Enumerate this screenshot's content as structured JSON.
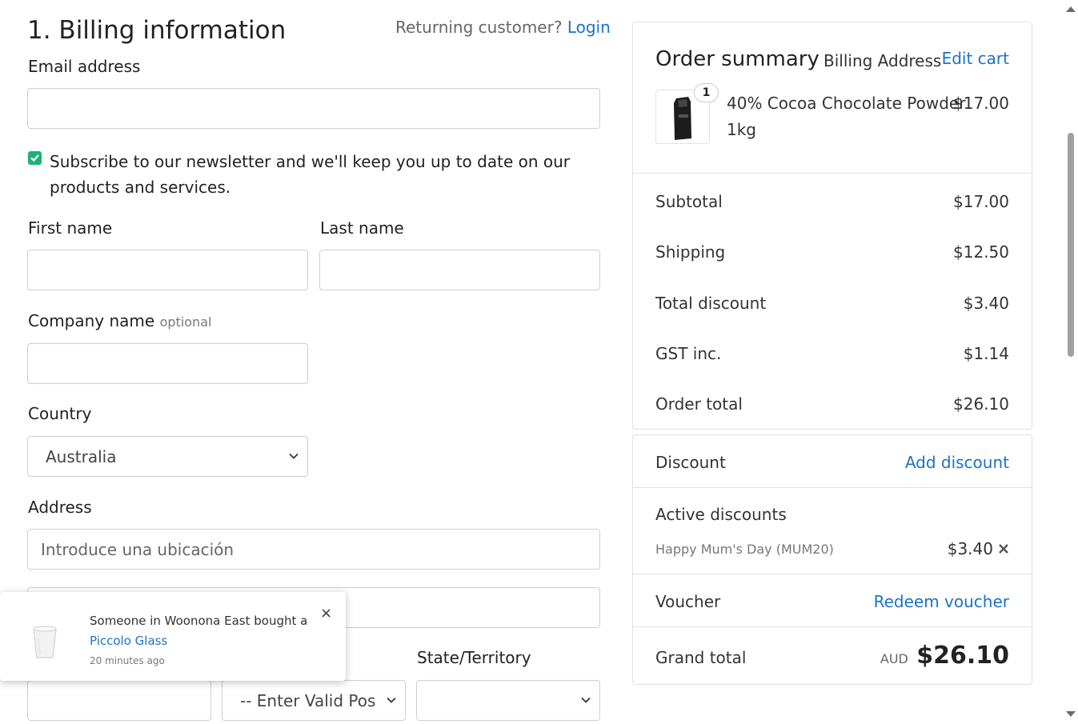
{
  "billing": {
    "title": "1. Billing information",
    "returning_text": "Returning customer?",
    "login_label": "Login",
    "email_label": "Email address",
    "newsletter_label": "Subscribe to our newsletter and we'll keep you up to date on our products and services.",
    "newsletter_checked": true,
    "first_name_label": "First name",
    "last_name_label": "Last name",
    "company_label": "Company name",
    "company_optional": "optional",
    "country_label": "Country",
    "country_value": "Australia",
    "address_label": "Address",
    "address_placeholder": "Introduce una ubicación",
    "state_label": "State/Territory",
    "postcode_select_value": "-- Enter Valid Post",
    "state_value": ""
  },
  "summary": {
    "title": "Order summary",
    "subtitle": "Billing Address",
    "edit_cart_label": "Edit cart",
    "item": {
      "name": "40% Cocoa Chocolate Powder",
      "variant": "1kg",
      "price": "$17.00",
      "quantity": "1"
    },
    "totals": [
      {
        "label": "Subtotal",
        "value": "$17.00"
      },
      {
        "label": "Shipping",
        "value": "$12.50"
      },
      {
        "label": "Total discount",
        "value": "$3.40"
      },
      {
        "label": "GST inc.",
        "value": "$1.14"
      },
      {
        "label": "Order total",
        "value": "$26.10"
      }
    ],
    "discount_label": "Discount",
    "add_discount_label": "Add discount",
    "active_discounts_label": "Active discounts",
    "active_discount_name": "Happy Mum's Day (MUM20)",
    "active_discount_value": "$3.40",
    "voucher_label": "Voucher",
    "redeem_voucher_label": "Redeem voucher",
    "grand_total_label": "Grand total",
    "grand_total_currency": "AUD",
    "grand_total_value": "$26.10"
  },
  "toast": {
    "message": "Someone in Woonona East bought a",
    "product": "Piccolo Glass",
    "time_ago": "20 minutes ago",
    "close": "×"
  },
  "colors": {
    "accent_link": "#1a73c8",
    "checkbox": "#20b07a"
  }
}
